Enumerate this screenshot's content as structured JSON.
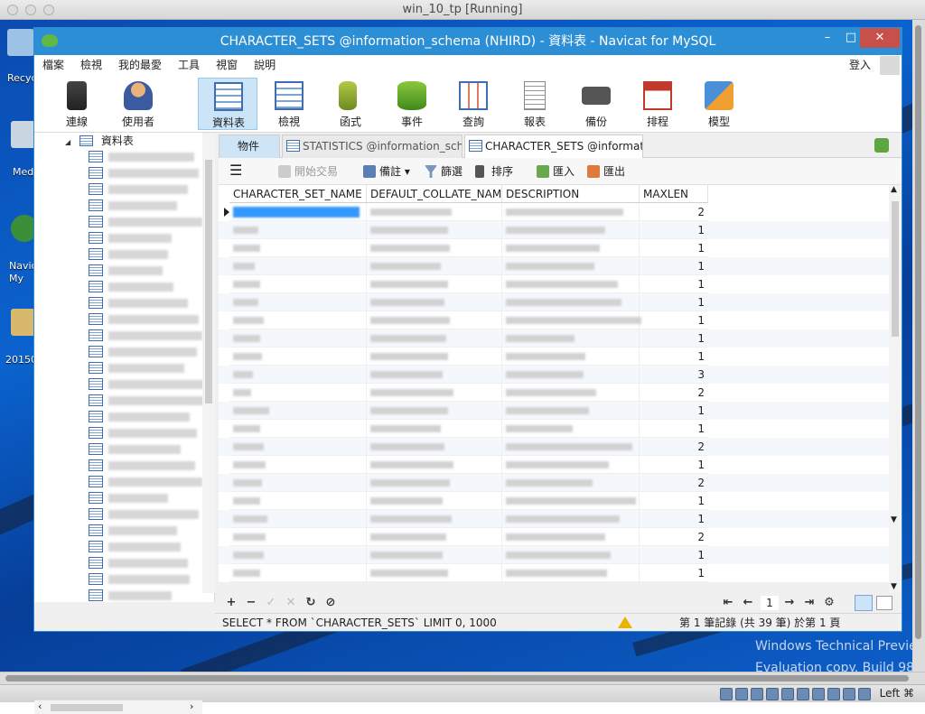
{
  "vm": {
    "title": "win_10_tp [Running]",
    "host_key": "Left ⌘"
  },
  "desktop": {
    "icons": [
      {
        "label": "Recyc"
      },
      {
        "label": "Med"
      },
      {
        "label": "Navic\nMy"
      },
      {
        "label": "20150"
      }
    ],
    "watermark_1": "Windows Technical Previe",
    "watermark_2": "Evaluation copy. Build 987"
  },
  "app": {
    "title": "CHARACTER_SETS @information_schema (NHIRD) - 資料表 - Navicat for MySQL",
    "window_buttons": {
      "minimize": "–",
      "maximize": "□",
      "close": "✕"
    },
    "menu": [
      "檔案",
      "檢視",
      "我的最愛",
      "工具",
      "視窗",
      "說明"
    ],
    "login": "登入",
    "toolbar": [
      {
        "label": "連線",
        "icon": "plug-icon"
      },
      {
        "label": "使用者",
        "icon": "user-icon"
      },
      {
        "label": "資料表",
        "icon": "table-icon"
      },
      {
        "label": "檢視",
        "icon": "view-icon"
      },
      {
        "label": "函式",
        "icon": "function-icon"
      },
      {
        "label": "事件",
        "icon": "event-icon"
      },
      {
        "label": "查詢",
        "icon": "query-icon"
      },
      {
        "label": "報表",
        "icon": "report-icon"
      },
      {
        "label": "備份",
        "icon": "backup-icon"
      },
      {
        "label": "排程",
        "icon": "schedule-icon"
      },
      {
        "label": "模型",
        "icon": "model-icon"
      }
    ],
    "nav": {
      "root_label": "資料表"
    },
    "tabs": {
      "objects": "物件",
      "tab1": "STATISTICS @information_sch...",
      "tab2": "CHARACTER_SETS @informati..."
    },
    "subtoolbar": {
      "begin_tx": "開始交易",
      "memo": "備註",
      "filter": "篩選",
      "sort": "排序",
      "import": "匯入",
      "export": "匯出"
    },
    "grid": {
      "columns": [
        "CHARACTER_SET_NAME",
        "DEFAULT_COLLATE_NAME",
        "DESCRIPTION",
        "MAXLEN"
      ],
      "maxlen": [
        "2",
        "1",
        "1",
        "1",
        "1",
        "1",
        "1",
        "1",
        "1",
        "3",
        "2",
        "1",
        "1",
        "2",
        "1",
        "2",
        "1",
        "1",
        "2",
        "1",
        "1"
      ]
    },
    "pager": {
      "page": "1"
    },
    "status": {
      "sql": "SELECT * FROM `CHARACTER_SETS` LIMIT 0, 1000",
      "records": "第 1 筆記錄 (共 39 筆) 於第 1 頁"
    }
  },
  "colors": {
    "titlebar": "#2c8fd6",
    "close": "#c7504a",
    "active_tool": "#cce4f7",
    "selected_cell": "#3399ff"
  }
}
